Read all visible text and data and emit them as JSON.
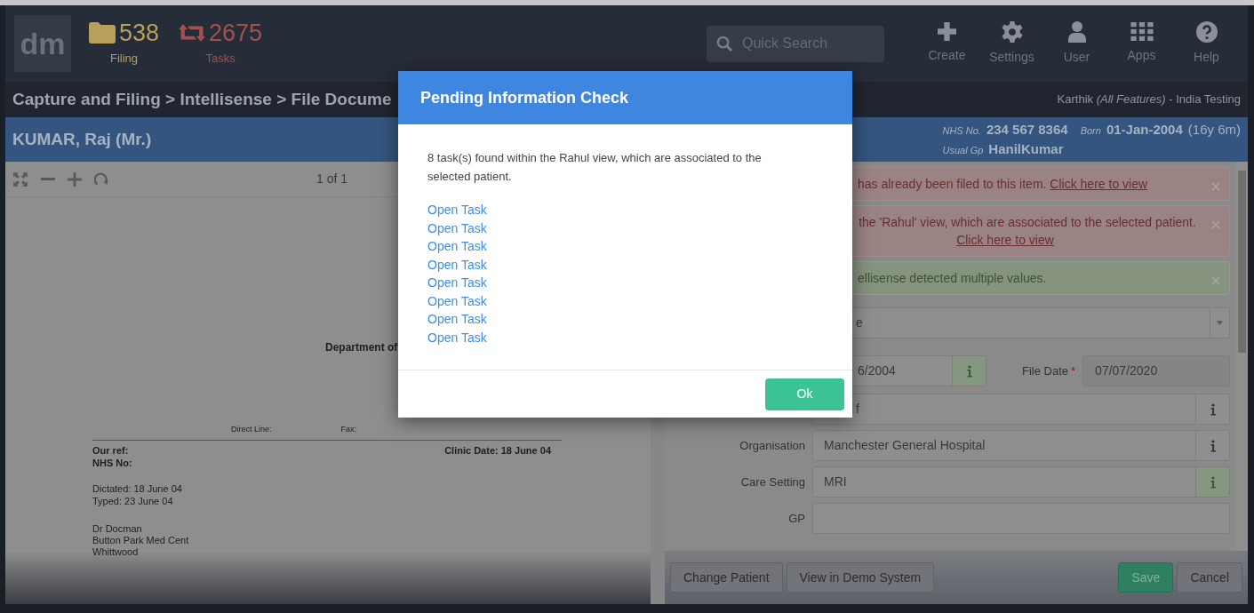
{
  "header": {
    "logo": "dm",
    "counters": [
      {
        "kind": "filing",
        "value": "538",
        "label": "Filing"
      },
      {
        "kind": "tasks",
        "value": "2675",
        "label": "Tasks"
      }
    ],
    "search": {
      "placeholder": "Quick Search"
    },
    "nav": [
      {
        "kind": "create",
        "label": "Create"
      },
      {
        "kind": "settings",
        "label": "Settings"
      },
      {
        "kind": "user",
        "label": "User"
      },
      {
        "kind": "apps",
        "label": "Apps"
      },
      {
        "kind": "help",
        "label": "Help"
      }
    ]
  },
  "breadcrumb": "Capture and Filing > Intellisense > File Docume",
  "user_info": "Karthik *(All Features)* - India Testing",
  "patient": {
    "name": "KUMAR, Raj (Mr.)",
    "nhs_label": "NHS No.",
    "nhs": "234 567 8364",
    "born_label": "Born",
    "born": "01-Jan-2004",
    "age": "(16y 6m)",
    "gp_label": "Usual Gp",
    "gp": "HanilKumar"
  },
  "viewer": {
    "page": "1 of 1",
    "document": {
      "department": "Department of",
      "direct_line": "Direct Line:",
      "fax": "Fax:",
      "our_ref": "Our ref:",
      "nhs_no": "NHS No:",
      "clinic_date": "Clinic Date: 18 June 04",
      "dictated": "Dictated: 18 June 04",
      "typed": "Typed: 23 June 04",
      "address": [
        "Dr Docman",
        "Button Park Med Cent",
        "Whittwood"
      ]
    }
  },
  "alerts": [
    {
      "kind": "error",
      "text": "has already been filed to this item.",
      "link": "Click here to view"
    },
    {
      "kind": "error",
      "text": "the 'Rahul' view, which are associated to the selected patient.",
      "link": "Click here to view"
    },
    {
      "kind": "success",
      "text": "ellisense detected multiple values."
    }
  ],
  "form": {
    "select_value": "e",
    "date_value": "6/2004",
    "date_info_matched": true,
    "file_date_label": "File Date",
    "file_date_required_mark": "*",
    "file_date_value": "07/07/2020",
    "field_value": "f",
    "field_info_matched": false,
    "rows": [
      {
        "label": "Organisation",
        "value": "Manchester General Hospital",
        "info": true,
        "matched": false
      },
      {
        "label": "Care Setting",
        "value": "MRI",
        "info": true,
        "matched": true
      },
      {
        "label": "GP",
        "value": "",
        "info": false
      }
    ]
  },
  "footer_buttons": [
    {
      "kind": "default",
      "label": "Change Patient"
    },
    {
      "kind": "default",
      "label": "View in Demo System"
    },
    {
      "kind": "primary",
      "label": "Save"
    },
    {
      "kind": "default",
      "label": "Cancel"
    }
  ],
  "modal": {
    "title": "Pending Information Check",
    "message": "8 task(s) found within the Rahul view, which are associated to the selected patient.",
    "links": [
      "Open Task",
      "Open Task",
      "Open Task",
      "Open Task",
      "Open Task",
      "Open Task",
      "Open Task",
      "Open Task"
    ],
    "ok": "Ok"
  }
}
